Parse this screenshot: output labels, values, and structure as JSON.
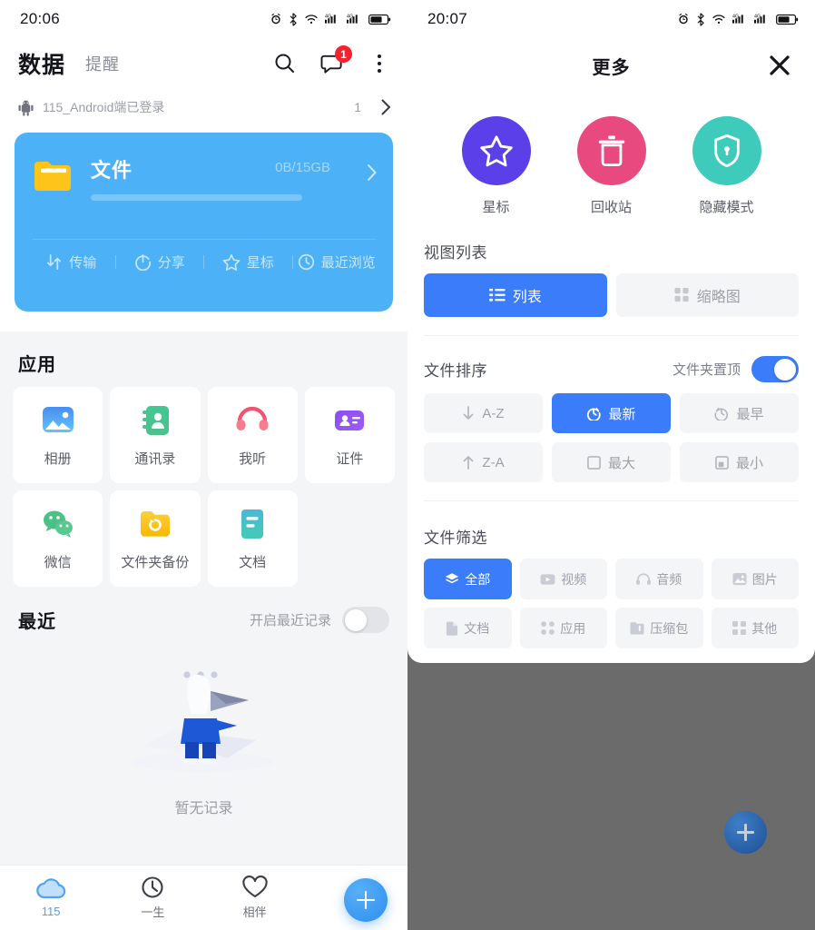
{
  "left": {
    "status": {
      "time": "20:06",
      "icons": [
        "alarm-icon",
        "bluetooth-icon",
        "wifi-icon",
        "signal-4g-1-icon",
        "signal-4g-2-icon",
        "battery-icon"
      ]
    },
    "header": {
      "tab_active": "数据",
      "tab_inactive": "提醒",
      "search_icon": "search-icon",
      "message_icon": "message-icon",
      "message_badge": "1",
      "more_icon": "kebab-menu-icon"
    },
    "device": {
      "icon": "android-icon",
      "name": "115_Android端已登录",
      "count": "1",
      "chevron": "chevron-right-icon"
    },
    "storage_card": {
      "icon": "folder-icon",
      "title": "文件",
      "quota": "0B/15GB",
      "progress_percent": 0,
      "arrow": "chevron-right-icon",
      "actions": [
        {
          "label": "传输",
          "icon": "transfer-icon"
        },
        {
          "label": "分享",
          "icon": "share-icon"
        },
        {
          "label": "星标",
          "icon": "star-icon"
        },
        {
          "label": "最近浏览",
          "icon": "history-icon"
        }
      ]
    },
    "apps": {
      "title": "应用",
      "items": [
        {
          "label": "相册",
          "icon": "photo-icon",
          "color": "#4aa3f5"
        },
        {
          "label": "通讯录",
          "icon": "contacts-icon",
          "color": "#44c48c"
        },
        {
          "label": "我听",
          "icon": "headphone-icon",
          "color": "#f4607a"
        },
        {
          "label": "证件",
          "icon": "id-card-icon",
          "color": "#8a4ef0"
        },
        {
          "label": "微信",
          "icon": "wechat-icon",
          "color": "#4cc185"
        },
        {
          "label": "文件夹备份",
          "icon": "folder-sync-icon",
          "color": "#ffc21a"
        },
        {
          "label": "文档",
          "icon": "document-icon",
          "color": "#41c2c2"
        }
      ]
    },
    "recent": {
      "title": "最近",
      "toggle_label": "开启最近记录",
      "toggle_on": false,
      "empty_text": "暂无记录",
      "illustration": "empty-box-mascot-illustration"
    },
    "bottom_nav": {
      "items": [
        {
          "label": "115",
          "icon": "cloud-icon",
          "active": true
        },
        {
          "label": "一生",
          "icon": "clock-icon",
          "active": false
        },
        {
          "label": "相伴",
          "icon": "heart-icon",
          "active": false
        }
      ],
      "fab": {
        "icon": "plus-icon",
        "label": ""
      }
    }
  },
  "right": {
    "status": {
      "time": "20:07",
      "icons": [
        "alarm-icon",
        "bluetooth-icon",
        "wifi-icon",
        "signal-4g-1-icon",
        "signal-4g-2-icon",
        "battery-icon"
      ]
    },
    "sheet": {
      "title": "更多",
      "close_icon": "close-icon",
      "shortcuts": [
        {
          "label": "星标",
          "icon": "star-icon",
          "color": "#5b3fe8"
        },
        {
          "label": "回收站",
          "icon": "trash-icon",
          "color": "#e8497e"
        },
        {
          "label": "隐藏模式",
          "icon": "shield-lock-icon",
          "color": "#3fcbbb"
        }
      ],
      "view_list": {
        "title": "视图列表",
        "options": [
          {
            "label": "列表",
            "icon": "list-icon",
            "active": true
          },
          {
            "label": "缩略图",
            "icon": "grid-icon",
            "active": false
          }
        ]
      },
      "file_sort": {
        "title": "文件排序",
        "folder_top_label": "文件夹置顶",
        "folder_top_on": true,
        "options": [
          {
            "label": "A-Z",
            "icon": "arrow-down-icon",
            "active": false
          },
          {
            "label": "最新",
            "icon": "clock-refresh-icon",
            "active": true
          },
          {
            "label": "最早",
            "icon": "clock-back-icon",
            "active": false
          },
          {
            "label": "Z-A",
            "icon": "arrow-up-icon",
            "active": false
          },
          {
            "label": "最大",
            "icon": "square-large-icon",
            "active": false
          },
          {
            "label": "最小",
            "icon": "square-small-icon",
            "active": false
          }
        ]
      },
      "file_filter": {
        "title": "文件筛选",
        "options": [
          {
            "label": "全部",
            "icon": "layers-icon",
            "active": true
          },
          {
            "label": "视频",
            "icon": "video-icon",
            "active": false
          },
          {
            "label": "音频",
            "icon": "audio-icon",
            "active": false
          },
          {
            "label": "图片",
            "icon": "image-icon",
            "active": false
          },
          {
            "label": "文档",
            "icon": "doc-icon",
            "active": false
          },
          {
            "label": "应用",
            "icon": "apps-icon",
            "active": false
          },
          {
            "label": "压缩包",
            "icon": "archive-icon",
            "active": false
          },
          {
            "label": "其他",
            "icon": "other-icon",
            "active": false
          }
        ]
      }
    },
    "fab": {
      "icon": "plus-icon"
    }
  },
  "theme": {
    "accent_blue": "#3b7cfb",
    "card_blue": "#4db1f7",
    "badge_red": "#f5222d",
    "bg_grey": "#f4f5f7",
    "overlay_grey": "#6b6b6b"
  }
}
